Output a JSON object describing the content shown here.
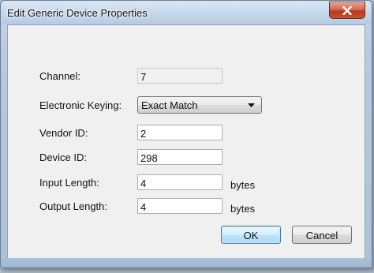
{
  "window": {
    "title": "Edit Generic Device Properties"
  },
  "form": {
    "channel_label": "Channel:",
    "channel_value": "7",
    "keying_label": "Electronic Keying:",
    "keying_value": "Exact Match",
    "vendor_label": "Vendor ID:",
    "vendor_value": "2",
    "device_label": "Device ID:",
    "device_value": "298",
    "input_label": "Input Length:",
    "input_value": "4",
    "input_unit": "bytes",
    "output_label": "Output Length:",
    "output_value": "4",
    "output_unit": "bytes"
  },
  "buttons": {
    "ok": "OK",
    "cancel": "Cancel"
  },
  "icons": {
    "close": "close-icon",
    "dropdown": "chevron-down-icon"
  },
  "colors": {
    "default_button_border": "#3c7fb1",
    "close_button": "#c9512f",
    "frame": "#aac2da"
  }
}
